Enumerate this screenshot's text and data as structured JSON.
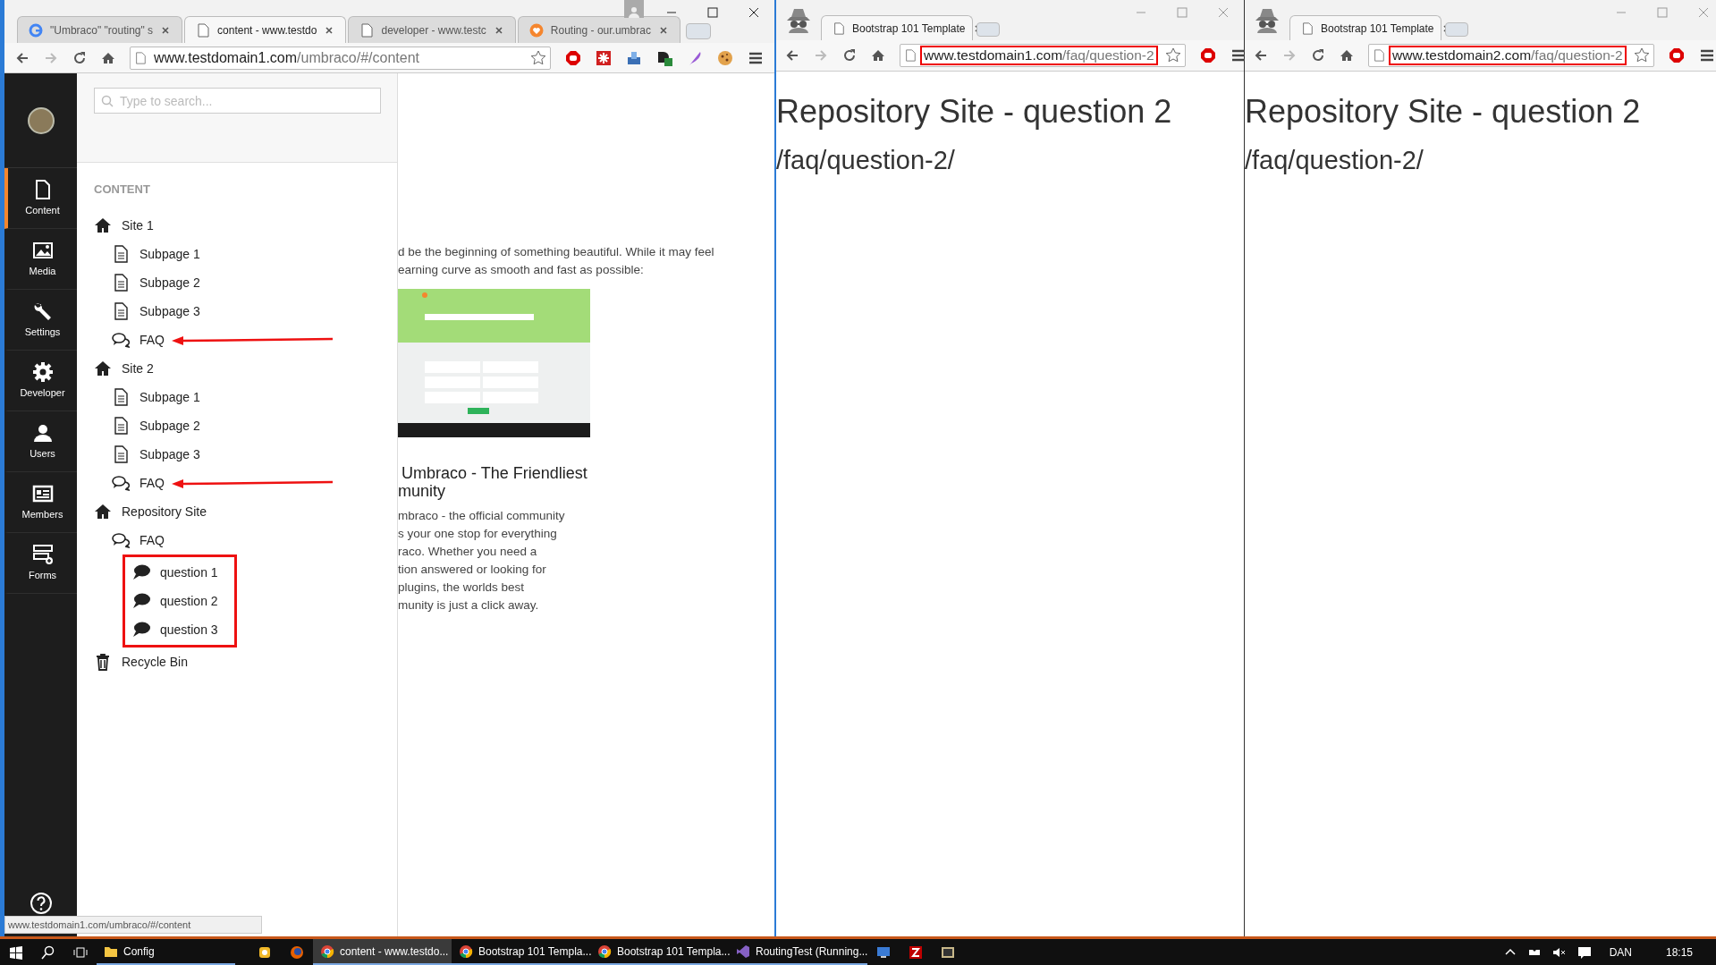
{
  "left_window": {
    "tabs": [
      {
        "title": "\"Umbraco\" \"routing\" s",
        "selected": false
      },
      {
        "title": "content - www.testdo",
        "selected": true
      },
      {
        "title": "developer - www.testc",
        "selected": false
      },
      {
        "title": "Routing - our.umbrac",
        "selected": false
      }
    ],
    "address": {
      "host": "www.testdomain1.com",
      "path": "/umbraco/#/content",
      "highlighted": false
    },
    "sections": [
      {
        "label": "Content",
        "selected": true
      },
      {
        "label": "Media",
        "selected": false
      },
      {
        "label": "Settings",
        "selected": false
      },
      {
        "label": "Developer",
        "selected": false
      },
      {
        "label": "Users",
        "selected": false
      },
      {
        "label": "Members",
        "selected": false
      },
      {
        "label": "Forms",
        "selected": false
      }
    ],
    "search": {
      "placeholder": "Type to search..."
    },
    "tree": {
      "heading": "CONTENT",
      "items": [
        {
          "label": "Site 1",
          "kind": "home",
          "annotated": false,
          "children_framed": false,
          "children": [
            {
              "label": "Subpage 1",
              "kind": "page",
              "annotated": false
            },
            {
              "label": "Subpage 2",
              "kind": "page",
              "annotated": false
            },
            {
              "label": "Subpage 3",
              "kind": "page",
              "annotated": false
            },
            {
              "label": "FAQ",
              "kind": "faq",
              "annotated": true
            }
          ]
        },
        {
          "label": "Site 2",
          "kind": "home",
          "annotated": false,
          "children_framed": false,
          "children": [
            {
              "label": "Subpage 1",
              "kind": "page",
              "annotated": false
            },
            {
              "label": "Subpage 2",
              "kind": "page",
              "annotated": false
            },
            {
              "label": "Subpage 3",
              "kind": "page",
              "annotated": false
            },
            {
              "label": "FAQ",
              "kind": "faq",
              "annotated": true
            }
          ]
        },
        {
          "label": "Repository Site",
          "kind": "home",
          "annotated": false,
          "children_framed": false,
          "children": [
            {
              "label": "FAQ",
              "kind": "faq",
              "annotated": false,
              "children_framed": true,
              "children": [
                {
                  "label": "question 1",
                  "kind": "question",
                  "annotated": false
                },
                {
                  "label": "question 2",
                  "kind": "question",
                  "annotated": false
                },
                {
                  "label": "question 3",
                  "kind": "question",
                  "annotated": false
                }
              ]
            }
          ]
        },
        {
          "label": "Recycle Bin",
          "kind": "bin",
          "annotated": false
        }
      ]
    },
    "intro_lines": [
      "d be the beginning of something beautiful. While it may feel",
      "earning curve as smooth and fast as possible:"
    ],
    "heading_lines": [
      "Umbraco - The Friendliest",
      "munity"
    ],
    "body_lines": [
      "mbraco - the official community",
      "s your one stop for everything",
      "raco. Whether you need a",
      "tion answered or looking for",
      "plugins, the worlds best",
      "munity is just a click away."
    ],
    "status_url": "www.testdomain1.com/umbraco/#/content"
  },
  "browser_windows": [
    {
      "tab_title": "Bootstrap 101 Template",
      "address": {
        "host": "www.testdomain1.com",
        "path": "/faq/question-2",
        "highlighted": true
      },
      "heading": "Repository Site - question 2",
      "path_text": "/faq/question-2/"
    },
    {
      "tab_title": "Bootstrap 101 Template",
      "address": {
        "host": "www.testdomain2.com",
        "path": "/faq/question-2",
        "highlighted": true
      },
      "heading": "Repository Site - question 2",
      "path_text": "/faq/question-2/"
    }
  ],
  "taskbar": {
    "items": [
      {
        "kind": "button",
        "selected": false
      },
      {
        "kind": "button",
        "selected": false
      },
      {
        "kind": "button",
        "selected": false
      },
      {
        "kind": "app",
        "label": "Config",
        "selected": false
      },
      {
        "kind": "button",
        "selected": false
      },
      {
        "kind": "button",
        "selected": false
      },
      {
        "kind": "app",
        "label": "content - www.testdo...",
        "selected": true
      },
      {
        "kind": "app",
        "label": "Bootstrap 101 Templa...",
        "selected": false
      },
      {
        "kind": "app",
        "label": "Bootstrap 101 Templa...",
        "selected": false
      },
      {
        "kind": "app",
        "label": "RoutingTest (Running...",
        "selected": false
      },
      {
        "kind": "button",
        "selected": false
      },
      {
        "kind": "button",
        "selected": false
      },
      {
        "kind": "button",
        "selected": false
      }
    ],
    "language": "DAN",
    "time": "18:15"
  }
}
